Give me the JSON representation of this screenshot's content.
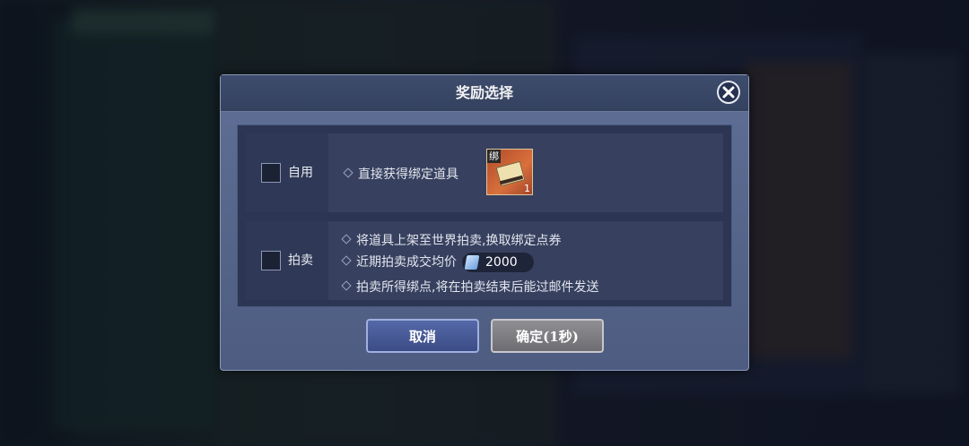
{
  "dialog": {
    "title": "奖励选择",
    "options": [
      {
        "checkbox_label": "自用",
        "checked": false,
        "bullets": [
          "直接获得绑定道具"
        ],
        "item": {
          "badge": "绑",
          "quantity": "1"
        }
      },
      {
        "checkbox_label": "拍卖",
        "checked": false,
        "bullets": [
          "将道具上架至世界拍卖,换取绑定点券",
          "近期拍卖成交均价",
          "拍卖所得绑点,将在拍卖结束后能过邮件发送"
        ],
        "avg_price": "2000"
      }
    ],
    "buttons": {
      "cancel": "取消",
      "confirm": "确定(1秒)"
    }
  },
  "icons": [
    "close-icon",
    "coupon-icon",
    "item-icon"
  ]
}
